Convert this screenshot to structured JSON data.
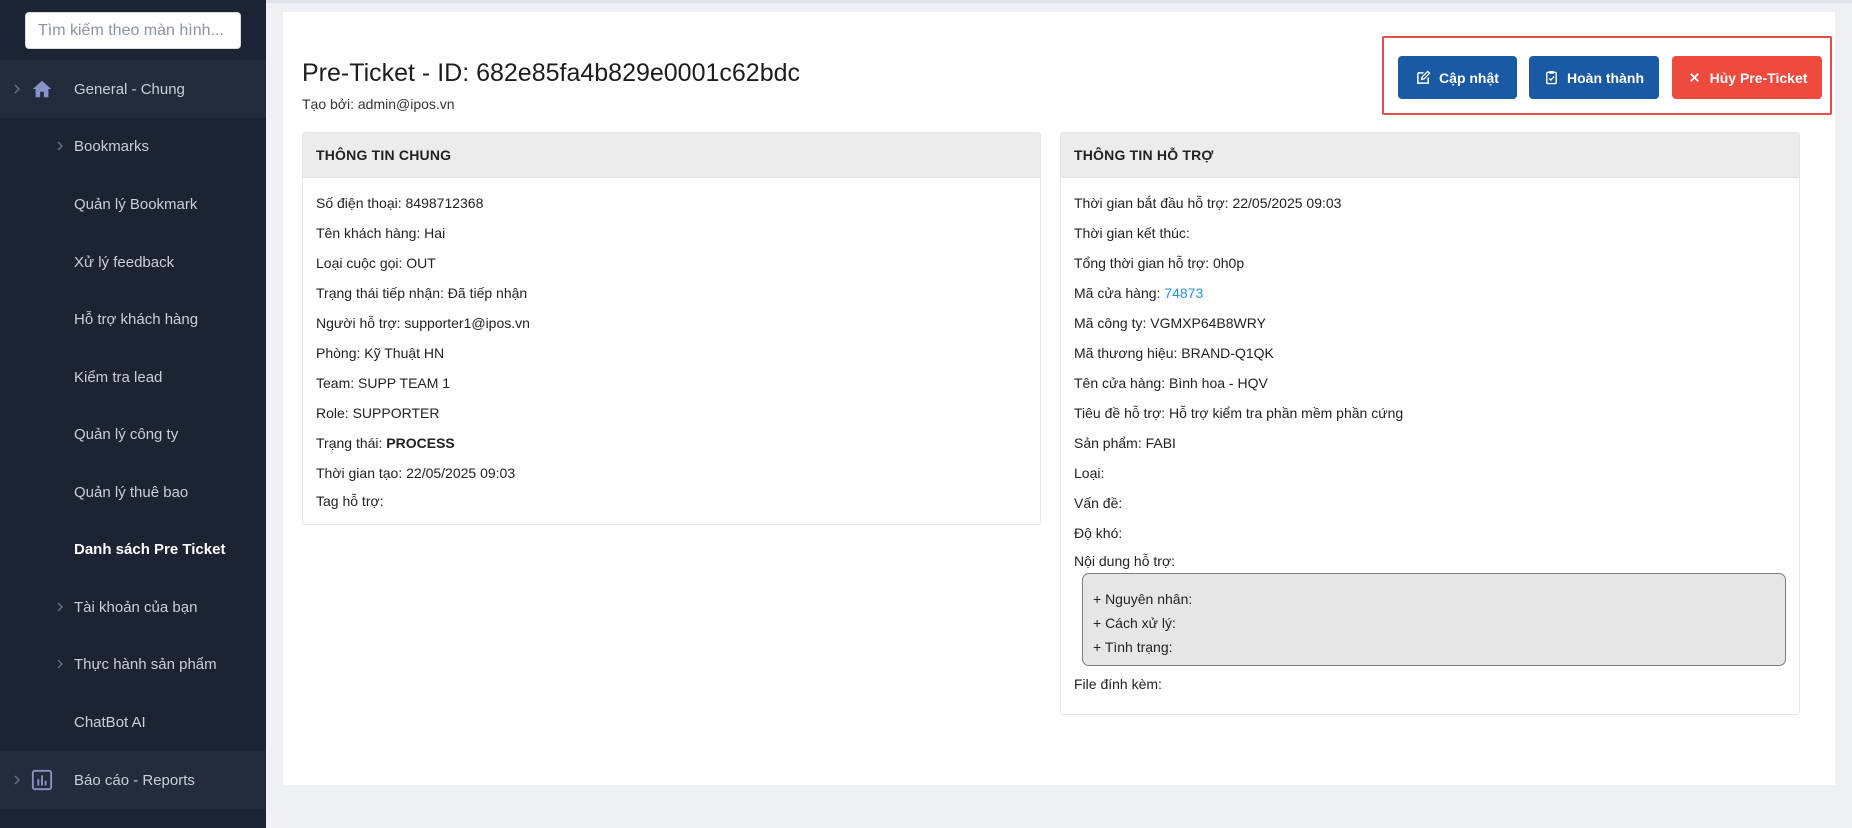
{
  "search": {
    "placeholder": "Tìm kiếm theo màn hình..."
  },
  "sidebar": {
    "items": [
      {
        "label": "General - Chung",
        "icon": "home-icon",
        "chevron": true,
        "section": true
      },
      {
        "label": "Bookmarks",
        "chevron": true
      },
      {
        "label": "Quản lý Bookmark"
      },
      {
        "label": "Xử lý feedback"
      },
      {
        "label": "Hỗ trợ khách hàng"
      },
      {
        "label": "Kiểm tra lead"
      },
      {
        "label": "Quản lý công ty"
      },
      {
        "label": "Quản lý thuê bao"
      },
      {
        "label": "Danh sách Pre Ticket",
        "active": true
      },
      {
        "label": "Tài khoản của bạn",
        "chevron": true
      },
      {
        "label": "Thực hành sản phẩm",
        "chevron": true
      },
      {
        "label": "ChatBot AI"
      },
      {
        "label": "Báo cáo - Reports",
        "icon": "bar-chart-icon",
        "chevron": true,
        "section": true
      }
    ]
  },
  "header": {
    "title": "Pre-Ticket - ID: 682e85fa4b829e0001c62bdc",
    "created_by": "Tạo bởi: admin@ipos.vn"
  },
  "actions": {
    "update_label": "Cập nhật",
    "complete_label": "Hoàn thành",
    "cancel_label": "Hủy Pre-Ticket",
    "highlight_color": "#e74c4c",
    "primary_color": "#1a5aa4",
    "danger_color": "#ef4a3e"
  },
  "general_info": {
    "title": "THÔNG TIN CHUNG",
    "phone": "Số điện thoại: 8498712368",
    "customer_name": "Tên khách hàng: Hai",
    "call_type": "Loại cuộc gọi: OUT",
    "receive_status": "Trạng thái tiếp nhận: Đã tiếp nhận",
    "supporter": "Người hỗ trợ: supporter1@ipos.vn",
    "department": "Phòng: Kỹ Thuật HN",
    "team": "Team: SUPP TEAM 1",
    "role": "Role: SUPPORTER",
    "status_label": "Trạng thái: ",
    "status_value": "PROCESS",
    "created_time": "Thời gian tạo: 22/05/2025 09:03",
    "support_tag": "Tag hỗ trợ:"
  },
  "support_info": {
    "title": "THÔNG TIN HỖ TRỢ",
    "start_time": "Thời gian bắt đầu hỗ trợ: 22/05/2025 09:03",
    "end_time": "Thời gian kết thúc:",
    "total_time": "Tổng thời gian hỗ trợ: 0h0p",
    "store_code_label": "Mã cửa hàng: ",
    "store_code_value": "74873",
    "company_code": "Mã công ty: VGMXP64B8WRY",
    "brand_code": "Mã thương hiệu: BRAND-Q1QK",
    "store_name": "Tên cửa hàng: Bình hoa - HQV",
    "support_subject": "Tiêu đề hỗ trợ: Hỗ trợ kiểm tra phần mềm phần cứng",
    "product": "Sản phẩm: FABI",
    "type": "Loại:",
    "issue": "Vấn đề:",
    "difficulty": "Độ khó:",
    "content_label": "Nội dung hỗ trợ:",
    "content_lines": [
      "+ Nguyên nhân:",
      "+ Cách xử lý:",
      "+ Tình trạng:"
    ],
    "attachments": "File đính kèm:"
  }
}
